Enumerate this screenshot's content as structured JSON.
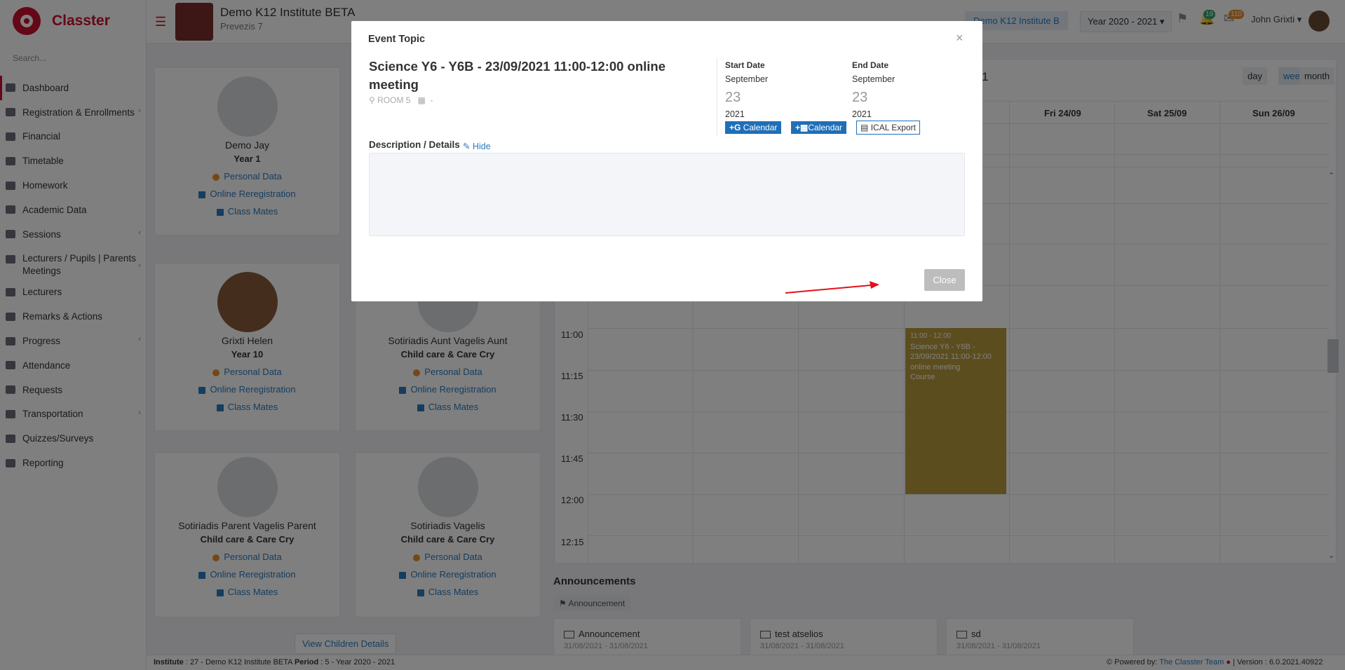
{
  "app": {
    "name": "Classter",
    "search_placeholder": "Search..."
  },
  "sidebar": {
    "items": [
      {
        "label": "Dashboard",
        "active": true
      },
      {
        "label": "Registration & Enrollments",
        "chevron": true
      },
      {
        "label": "Financial"
      },
      {
        "label": "Timetable"
      },
      {
        "label": "Homework"
      },
      {
        "label": "Academic Data"
      },
      {
        "label": "Sessions",
        "chevron": true
      },
      {
        "label": "Lecturers / Pupils | Parents Meetings",
        "chevron": true
      },
      {
        "label": "Lecturers"
      },
      {
        "label": "Remarks & Actions"
      },
      {
        "label": "Progress",
        "chevron": true
      },
      {
        "label": "Attendance"
      },
      {
        "label": "Requests"
      },
      {
        "label": "Transportation",
        "chevron": true
      },
      {
        "label": "Quizzes/Surveys"
      },
      {
        "label": "Reporting"
      }
    ]
  },
  "header": {
    "institute_name": "Demo K12 Institute BETA",
    "institute_address": "Prevezis 7",
    "institute_button": "Demo K12 Institute B",
    "year_select": "Year 2020 - 2021",
    "notifications_count": "19",
    "messages_count": "110",
    "user_name": "John Grixti"
  },
  "cards": [
    {
      "name": "Demo Jay",
      "class": "Year 1"
    },
    {
      "name": "Grixti Helen",
      "class": "Year 10"
    },
    {
      "name": "Sotiriadis Aunt Vagelis Aunt",
      "class": "Child care & Care Cry"
    },
    {
      "name": "Sotiriadis Parent Vagelis Parent",
      "class": "Child care & Care Cry"
    },
    {
      "name": "Sotiriadis Vagelis",
      "class": "Child care & Care Cry"
    }
  ],
  "card_links": {
    "personal": "Personal Data",
    "rereg": "Online Reregistration",
    "mates": "Class Mates"
  },
  "view_children": "View Children Details",
  "calendar": {
    "title_fragment": "1",
    "views": [
      "day",
      "week",
      "month"
    ],
    "days": [
      "Fri 24/09",
      "Sat 25/09",
      "Sun 26/09"
    ],
    "times": [
      "11:00",
      "11:15",
      "11:30",
      "11:45",
      "12:00",
      "12:15"
    ],
    "event": {
      "time": "11:00 - 12:00",
      "title": "Science Y6 - Y6B - 23/09/2021 11:00-12:00 online meeting",
      "type": "Course"
    }
  },
  "announcements": {
    "title": "Announcements",
    "tag": "Announcement",
    "items": [
      {
        "title": "Announcement",
        "dates": "31/08/2021 - 31/08/2021"
      },
      {
        "title": "test atselios",
        "dates": "31/08/2021 - 31/08/2021"
      },
      {
        "title": "sd",
        "dates": "31/08/2021 - 31/08/2021"
      }
    ]
  },
  "footer": {
    "institute_label": "Institute",
    "institute_value": ": 27 - Demo K12 Institute BETA",
    "period_label": "Period",
    "period_value": ": 5 - Year 2020 - 2021",
    "powered_by": "Powered by:",
    "team": "The Classter Team",
    "version": "| Version : 6.0.2021.40922"
  },
  "modal": {
    "header": "Event Topic",
    "title": "Science Y6 - Y6B - 23/09/2021 11:00-12:00 online meeting",
    "room": "ROOM 5",
    "building": "-",
    "start_label": "Start Date",
    "start_month": "September",
    "start_day": "23",
    "start_year": "2021",
    "end_label": "End Date",
    "end_month": "September",
    "end_day": "23",
    "end_year": "2021",
    "google_btn": "Calendar",
    "outlook_btn": "Calendar",
    "ical_btn": "ICAL Export",
    "desc_label": "Description / Details",
    "hide_link": "Hide",
    "close_btn": "Close"
  },
  "colors": {
    "brand": "#c8102e",
    "link": "#2a7abf",
    "event": "#b89a3e",
    "button": "#1f6fb8"
  }
}
